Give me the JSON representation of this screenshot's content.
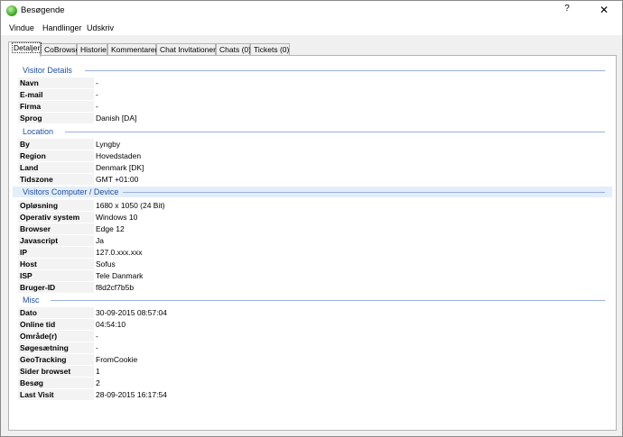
{
  "window": {
    "title": "Besøgende",
    "help": "?",
    "close": "✕"
  },
  "menu": [
    "Vindue",
    "Handlinger",
    "Udskriv"
  ],
  "tabs": [
    "Detaljer",
    "CoBrowse",
    "Historie",
    "Kommentarer",
    "Chat Invitationer",
    "Chats (0)",
    "Tickets (0)"
  ],
  "sections": [
    {
      "title": "Visitor Details",
      "rows": [
        {
          "label": "Navn",
          "value": "-"
        },
        {
          "label": "E-mail",
          "value": "-"
        },
        {
          "label": "Firma",
          "value": "-"
        },
        {
          "label": "Sprog",
          "value": "Danish [DA]"
        }
      ]
    },
    {
      "title": "Location",
      "rows": [
        {
          "label": "By",
          "value": "Lyngby"
        },
        {
          "label": "Region",
          "value": "Hovedstaden"
        },
        {
          "label": "Land",
          "value": "Denmark [DK]"
        },
        {
          "label": "Tidszone",
          "value": "GMT +01:00"
        }
      ]
    },
    {
      "title": "Visitors Computer / Device",
      "rows": [
        {
          "label": "Opløsning",
          "value": "1680 x 1050 (24 Bit)"
        },
        {
          "label": "Operativ system",
          "value": "Windows 10"
        },
        {
          "label": "Browser",
          "value": "Edge 12"
        },
        {
          "label": "Javascript",
          "value": "Ja"
        },
        {
          "label": "IP",
          "value": "127.0.xxx.xxx"
        },
        {
          "label": "Host",
          "value": "Sofus"
        },
        {
          "label": "ISP",
          "value": "Tele Danmark"
        },
        {
          "label": "Bruger-ID",
          "value": "f8d2cf7b5b"
        }
      ]
    },
    {
      "title": "Misc",
      "rows": [
        {
          "label": "Dato",
          "value": "30-09-2015 08:57:04"
        },
        {
          "label": "Online tid",
          "value": "04:54:10"
        },
        {
          "label": "Område(r)",
          "value": "-"
        },
        {
          "label": "Søgesætning",
          "value": "-"
        },
        {
          "label": "GeoTracking",
          "value": "FromCookie"
        },
        {
          "label": "Sider browset",
          "value": "1"
        },
        {
          "label": "Besøg",
          "value": "2"
        },
        {
          "label": "Last Visit",
          "value": "28-09-2015 16:17:54"
        }
      ]
    }
  ]
}
